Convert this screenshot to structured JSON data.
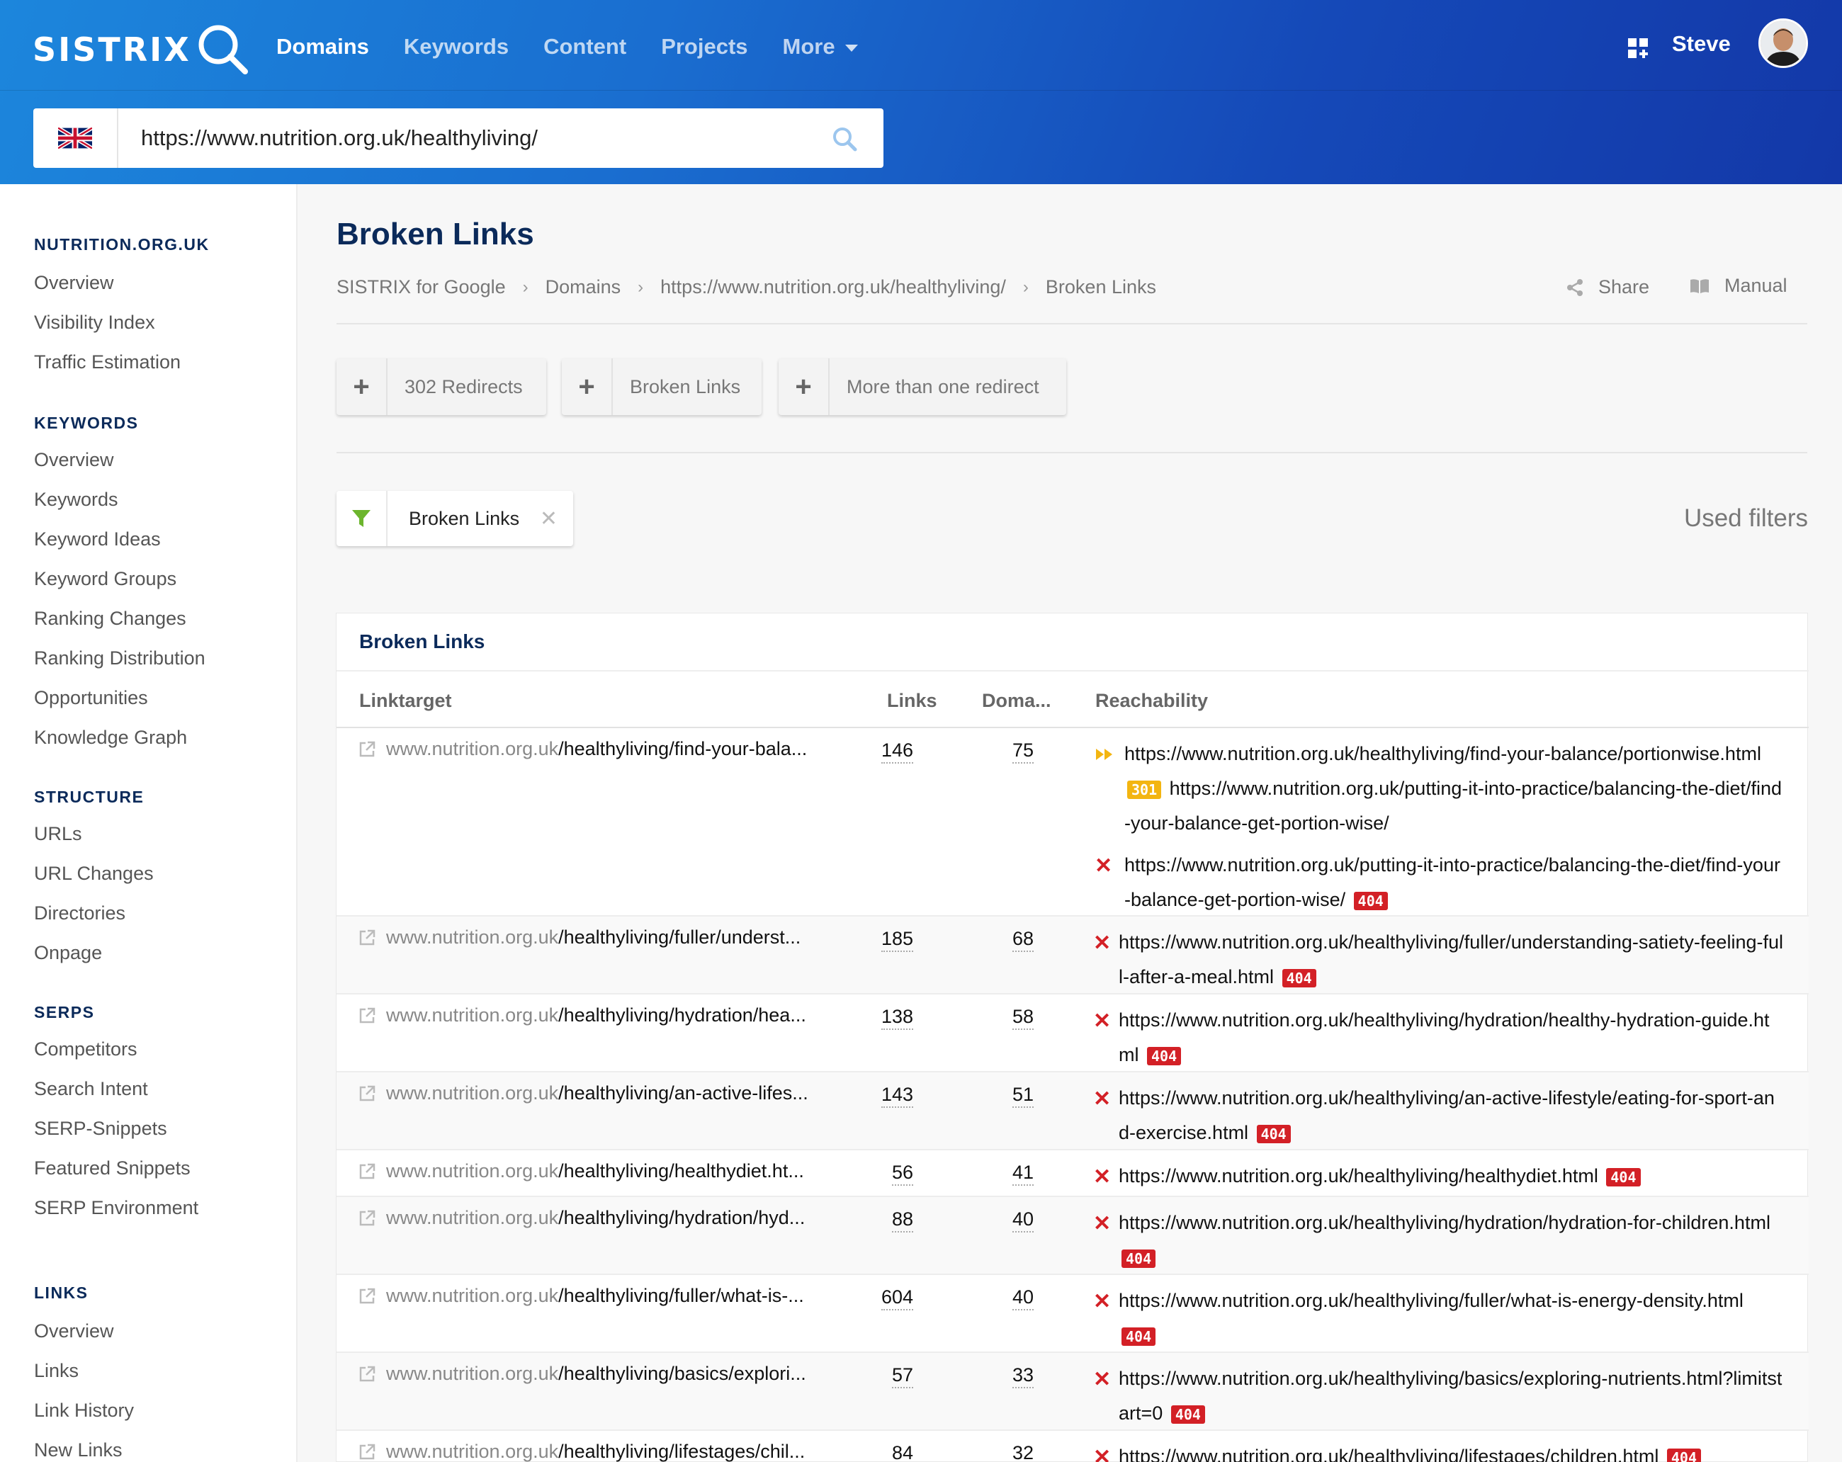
{
  "app": {
    "logo": "SISTRIX",
    "nav": [
      {
        "label": "Domains",
        "active": true
      },
      {
        "label": "Keywords",
        "active": false
      },
      {
        "label": "Content",
        "active": false
      },
      {
        "label": "Projects",
        "active": false
      },
      {
        "label": "More",
        "active": false
      }
    ],
    "user": "Steve",
    "search_value": "https://www.nutrition.org.uk/healthyliving/",
    "country_flag": "uk-flag-icon"
  },
  "sidebar": {
    "sections": [
      {
        "title": "NUTRITION.ORG.UK",
        "items": [
          "Overview",
          "Visibility Index",
          "Traffic Estimation"
        ]
      },
      {
        "title": "KEYWORDS",
        "items": [
          "Overview",
          "Keywords",
          "Keyword Ideas",
          "Keyword Groups",
          "Ranking Changes",
          "Ranking Distribution",
          "Opportunities",
          "Knowledge Graph"
        ]
      },
      {
        "title": "STRUCTURE",
        "items": [
          "URLs",
          "URL Changes",
          "Directories",
          "Onpage"
        ]
      },
      {
        "title": "SERPS",
        "items": [
          "Competitors",
          "Search Intent",
          "SERP-Snippets",
          "Featured Snippets",
          "SERP Environment"
        ]
      },
      {
        "title": "LINKS",
        "items": [
          "Overview",
          "Links",
          "Link History",
          "New Links"
        ]
      }
    ]
  },
  "page": {
    "title": "Broken Links",
    "breadcrumb": [
      "SISTRIX for Google",
      "Domains",
      "https://www.nutrition.org.uk/healthyliving/",
      "Broken Links"
    ],
    "share": "Share",
    "manual": "Manual",
    "quick_filters": [
      "302 Redirects",
      "Broken Links",
      "More than one redirect"
    ],
    "active_filter": "Broken Links",
    "used_filters": "Used filters"
  },
  "table": {
    "title": "Broken Links",
    "columns": {
      "target": "Linktarget",
      "links": "Links",
      "domains": "Doma...",
      "reach": "Reachability"
    },
    "host": "www.nutrition.org.uk",
    "rows": [
      {
        "path": "/healthyliving/find-your-bala...",
        "links": "146",
        "domains": "75",
        "redirect_url": "https://www.nutrition.org.uk/healthyliving/find-your-balance/portionwise.html",
        "redirect_code": "301",
        "redirect_target": "https://www.nutrition.org.uk/putting-it-into-practice/balancing-the-diet/find-your-balance-get-portion-wise/",
        "broken_url": "https://www.nutrition.org.uk/putting-it-into-practice/balancing-the-diet/find-your-balance-get-portion-wise/",
        "code": "404"
      },
      {
        "path": "/healthyliving/fuller/underst...",
        "links": "185",
        "domains": "68",
        "broken_url": "https://www.nutrition.org.uk/healthyliving/fuller/understanding-satiety-feeling-full-after-a-meal.html",
        "code": "404"
      },
      {
        "path": "/healthyliving/hydration/hea...",
        "links": "138",
        "domains": "58",
        "broken_url": "https://www.nutrition.org.uk/healthyliving/hydration/healthy-hydration-guide.html",
        "code": "404"
      },
      {
        "path": "/healthyliving/an-active-lifes...",
        "links": "143",
        "domains": "51",
        "broken_url": "https://www.nutrition.org.uk/healthyliving/an-active-lifestyle/eating-for-sport-and-exercise.html",
        "code": "404"
      },
      {
        "path": "/healthyliving/healthydiet.ht...",
        "links": "56",
        "domains": "41",
        "broken_url": "https://www.nutrition.org.uk/healthyliving/healthydiet.html",
        "code": "404"
      },
      {
        "path": "/healthyliving/hydration/hyd...",
        "links": "88",
        "domains": "40",
        "broken_url": "https://www.nutrition.org.uk/healthyliving/hydration/hydration-for-children.html",
        "code": "404"
      },
      {
        "path": "/healthyliving/fuller/what-is-...",
        "links": "604",
        "domains": "40",
        "broken_url": "https://www.nutrition.org.uk/healthyliving/fuller/what-is-energy-density.html",
        "code": "404"
      },
      {
        "path": "/healthyliving/basics/explori...",
        "links": "57",
        "domains": "33",
        "broken_url": "https://www.nutrition.org.uk/healthyliving/basics/exploring-nutrients.html?limitstart=0",
        "code": "404"
      },
      {
        "path": "/healthyliving/lifestages/chil...",
        "links": "84",
        "domains": "32",
        "broken_url": "https://www.nutrition.org.uk/healthyliving/lifestages/children.html",
        "code": "404"
      }
    ]
  },
  "colors": {
    "accent": "#1a6ed0",
    "navy": "#0b2a5a",
    "error": "#d32026",
    "warning": "#f3b511",
    "filter_green": "#6cb52d"
  }
}
